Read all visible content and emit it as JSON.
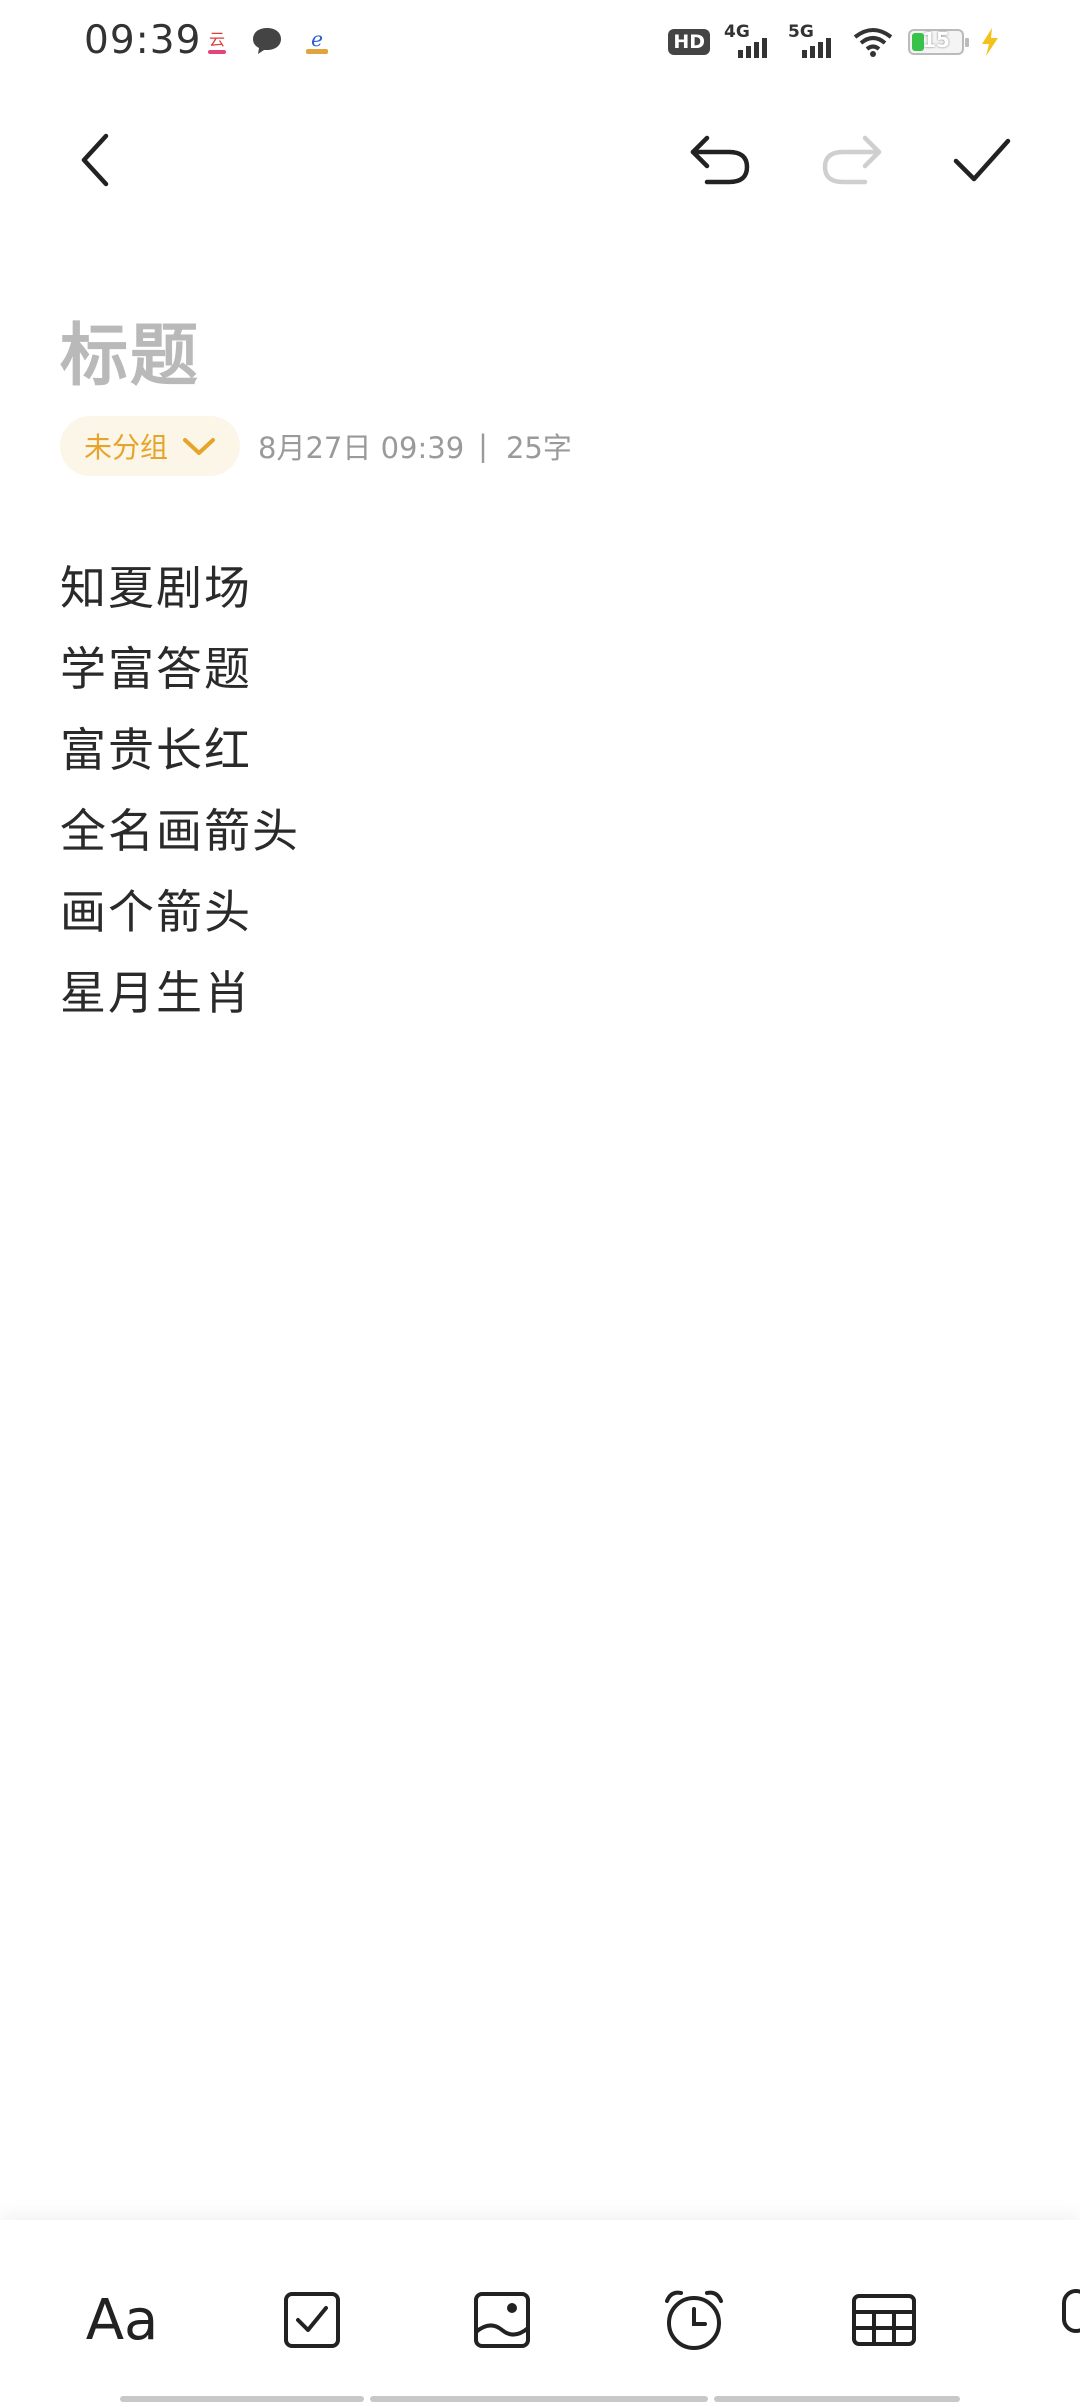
{
  "status_bar": {
    "time": "09:39",
    "notification_icons": [
      "app-notification-icon",
      "message-bubble-icon",
      "telecom-icon"
    ],
    "hd": "HD",
    "net1": "4G",
    "net2": "5G",
    "battery": "15"
  },
  "topbar": {
    "icons": [
      "back-icon",
      "undo-icon",
      "redo-icon",
      "check-icon"
    ]
  },
  "note": {
    "title_placeholder": "标题",
    "group": "未分组",
    "date": "8月27日 09:39",
    "separator": "|",
    "char_count": "25字",
    "lines": [
      "知夏剧场",
      "学富答题",
      "富贵长红",
      "全名画箭头",
      "画个箭头",
      "星月生肖"
    ]
  },
  "toolbar": {
    "text_style_label": "Aa",
    "icons": [
      "text-style-icon",
      "checklist-icon",
      "image-icon",
      "reminder-alarm-icon",
      "table-icon",
      "microphone-icon"
    ]
  },
  "colors": {
    "accent": "#e7a42b",
    "chip_bg": "#fbf6e8",
    "battery_fill": "#38c24a",
    "placeholder": "#b9b9b9"
  }
}
